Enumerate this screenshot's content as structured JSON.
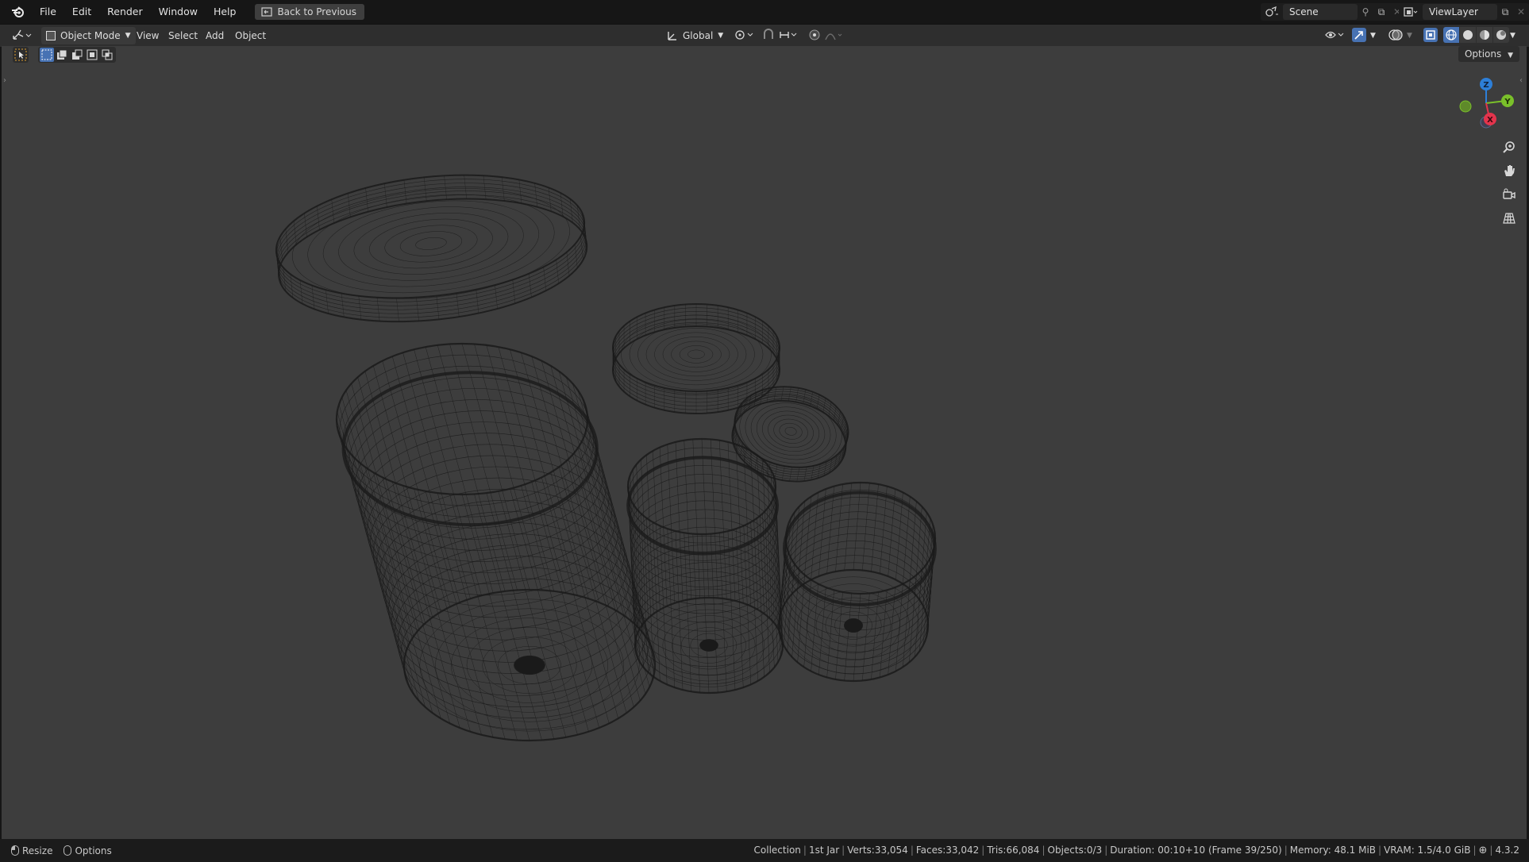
{
  "menu": {
    "items": [
      "File",
      "Edit",
      "Render",
      "Window",
      "Help"
    ],
    "back_button": "Back to Previous"
  },
  "scene": {
    "label": "Scene"
  },
  "view_layer": {
    "label": "ViewLayer"
  },
  "header": {
    "mode": "Object Mode",
    "menus": [
      "View",
      "Select",
      "Add",
      "Object"
    ],
    "transform_orientation": "Global"
  },
  "viewport": {
    "options_label": "Options",
    "gizmo": {
      "z": "Z",
      "y": "Y",
      "x": "X"
    },
    "background": "#3d3d3d",
    "wire_color": "#1a1a1a"
  },
  "statusbar": {
    "left": [
      {
        "icon": "mouse-left-icon",
        "label": "Resize"
      },
      {
        "icon": "mouse-right-icon",
        "label": "Options"
      }
    ],
    "collection": "Collection",
    "object": "1st Jar",
    "verts": "Verts:33,054",
    "faces": "Faces:33,042",
    "tris": "Tris:66,084",
    "objects": "Objects:0/3",
    "duration": "Duration: 00:10+10 (Frame 39/250)",
    "memory": "Memory: 48.1 MiB",
    "vram": "VRAM: 1.5/4.0 GiB",
    "version": "4.3.2"
  }
}
